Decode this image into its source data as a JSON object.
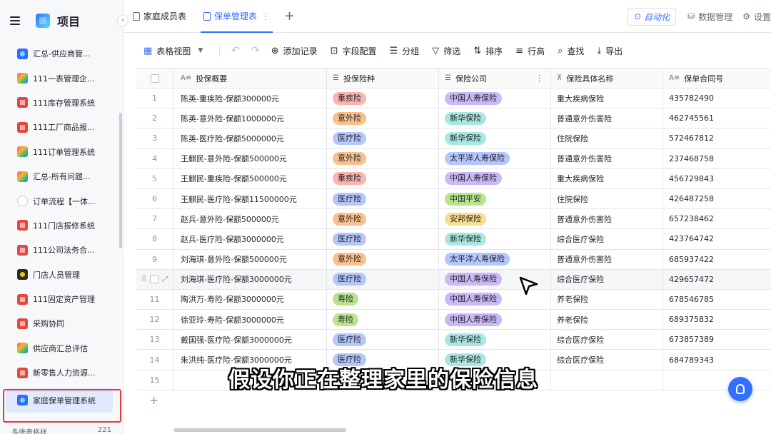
{
  "sidebar": {
    "title": "项目",
    "items": [
      {
        "label": "汇总-供应商管...",
        "icon": "blue"
      },
      {
        "label": "111一表管理企...",
        "icon": "multi"
      },
      {
        "label": "111库存管理系统",
        "icon": "red"
      },
      {
        "label": "111工厂商品报...",
        "icon": "red"
      },
      {
        "label": "111订单管理系统",
        "icon": "multi"
      },
      {
        "label": "汇总-所有问题...",
        "icon": "multi"
      },
      {
        "label": "订单流程【一体...",
        "icon": "flow"
      },
      {
        "label": "111门店报修系统",
        "icon": "red"
      },
      {
        "label": "111公司法务合...",
        "icon": "red"
      },
      {
        "label": "门店人员管理",
        "icon": "dark"
      },
      {
        "label": "111固定资产管理",
        "icon": "red"
      },
      {
        "label": "采购协同",
        "icon": "red"
      },
      {
        "label": "供应商汇总评估",
        "icon": "multi"
      },
      {
        "label": "新零售人力资源...",
        "icon": "red"
      }
    ],
    "active_item": "家庭保单管理系统",
    "bottom_label": "多维表格样",
    "bottom_count": "221"
  },
  "tabs": [
    {
      "label": "家庭成员表",
      "active": false
    },
    {
      "label": "保单管理表",
      "active": true
    }
  ],
  "top_right": {
    "automation": "自动化",
    "data_manage": "数据管理",
    "settings": "设置"
  },
  "toolbar": {
    "view": "表格视图",
    "add_record": "添加记录",
    "field_config": "字段配置",
    "group": "分组",
    "filter": "筛选",
    "sort": "排序",
    "row_height": "行高",
    "search": "查找",
    "export": "导出"
  },
  "columns": [
    "投保概要",
    "投保险种",
    "保险公司",
    "保险具体名称",
    "保单合同号"
  ],
  "tag_colors": {
    "重疾险": "#f9b5ae",
    "意外险": "#fbbf8c",
    "医疗险": "#b4c6fb",
    "寿险": "#b7e48c",
    "中国人寿保险": "#cbb9f7",
    "新华保险": "#a9e8e0",
    "太平洋人寿保险": "#b4c6fb",
    "中国平安": "#b7e48c",
    "安邦保险": "#f9dc8c"
  },
  "rows": [
    {
      "no": "1",
      "summary": "陈英-重疾险-保额300000元",
      "type": "重疾险",
      "company": "中国人寿保险",
      "name": "重大疾病保险",
      "contract": "435782490"
    },
    {
      "no": "2",
      "summary": "陈英-意外险-保额1000000元",
      "type": "意外险",
      "company": "新华保险",
      "name": "普通意外伤害险",
      "contract": "462745561"
    },
    {
      "no": "3",
      "summary": "陈英-医疗险-保额5000000元",
      "type": "医疗险",
      "company": "新华保险",
      "name": "住院保险",
      "contract": "572467812"
    },
    {
      "no": "4",
      "summary": "王麒民-意外险-保额500000元",
      "type": "意外险",
      "company": "太平洋人寿保险",
      "name": "普通意外伤害险",
      "contract": "237468758"
    },
    {
      "no": "5",
      "summary": "王麒民-重疾险-保额500000元",
      "type": "重疾险",
      "company": "中国人寿保险",
      "name": "重大疾病保险",
      "contract": "456729843"
    },
    {
      "no": "6",
      "summary": "王麒民-医疗险-保额11500000元",
      "type": "医疗险",
      "company": "中国平安",
      "name": "住院保险",
      "contract": "426487258"
    },
    {
      "no": "7",
      "summary": "赵兵-意外险-保额500000元",
      "type": "意外险",
      "company": "安邦保险",
      "name": "普通意外伤害险",
      "contract": "657238462"
    },
    {
      "no": "8",
      "summary": "赵兵-医疗险-保额3000000元",
      "type": "医疗险",
      "company": "新华保险",
      "name": "综合医疗保险",
      "contract": "423764742"
    },
    {
      "no": "9",
      "summary": "刘海琪-意外险-保额500000元",
      "type": "意外险",
      "company": "太平洋人寿保险",
      "name": "普通意外伤害险",
      "contract": "685937422"
    },
    {
      "no": "",
      "summary": "刘海琪-医疗险-保额3000000元",
      "type": "医疗险",
      "company": "中国人寿保险",
      "name": "综合医疗保险",
      "contract": "429657472"
    },
    {
      "no": "11",
      "summary": "陶洪万-寿险-保额3000000元",
      "type": "寿险",
      "company": "中国人寿保险",
      "name": "养老保险",
      "contract": "678546785"
    },
    {
      "no": "12",
      "summary": "徐亚玲-寿险-保额3000000元",
      "type": "寿险",
      "company": "中国人寿保险",
      "name": "养老保险",
      "contract": "689375832"
    },
    {
      "no": "13",
      "summary": "戴国强-医疗险-保额3000000元",
      "type": "医疗险",
      "company": "新华保险",
      "name": "综合医疗保险",
      "contract": "673857389"
    },
    {
      "no": "14",
      "summary": "朱洪纯-医疗险-保额3000000元",
      "type": "医疗险",
      "company": "新华保险",
      "name": "综合医疗保险",
      "contract": "684789343"
    },
    {
      "no": "15",
      "summary": "",
      "type": "",
      "company": "",
      "name": "",
      "contract": ""
    }
  ],
  "subtitle": "假设你正在整理家里的保险信息"
}
